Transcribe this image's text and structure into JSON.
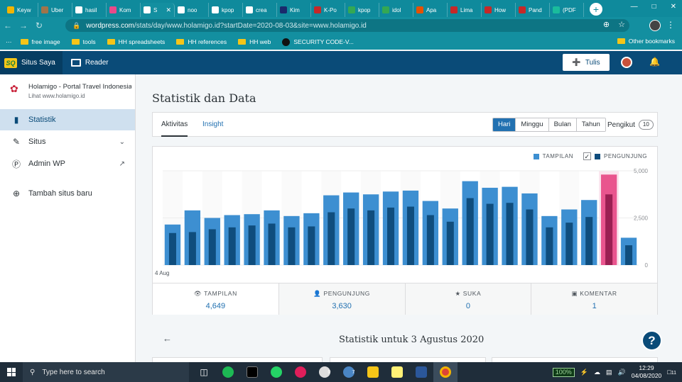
{
  "browser": {
    "tabs": [
      {
        "label": "Keyw",
        "color": "#f4b400"
      },
      {
        "label": "Uber",
        "color": "#a0744a"
      },
      {
        "label": "hasil",
        "color": "#ffffff"
      },
      {
        "label": "Kom",
        "color": "#e84a8a"
      },
      {
        "label": "S",
        "color": "#ffffff",
        "active": true
      },
      {
        "label": "noo",
        "color": "#ffffff"
      },
      {
        "label": "kpop",
        "color": "#ffffff"
      },
      {
        "label": "crea",
        "color": "#ffffff"
      },
      {
        "label": "Kim",
        "color": "#1a2a6c"
      },
      {
        "label": "K-Po",
        "color": "#c62828"
      },
      {
        "label": "kpop",
        "color": "#34a853"
      },
      {
        "label": "idol",
        "color": "#34a853"
      },
      {
        "label": "Apa",
        "color": "#e65100"
      },
      {
        "label": "Lima",
        "color": "#c62828"
      },
      {
        "label": "How",
        "color": "#c62828"
      },
      {
        "label": "Pand",
        "color": "#c62828"
      },
      {
        "label": "(PDF",
        "color": "#1abc9c"
      }
    ],
    "url_host": "wordpress.com",
    "url_rest": "/stats/day/www.holamigo.id?startDate=2020-08-03&site=www.holamigo.id",
    "bookmarks": [
      "free image",
      "tools",
      "HH spreadsheets",
      "HH references",
      "HH web",
      "SECURITY CODE-V..."
    ],
    "other_bookmarks": "Other bookmarks"
  },
  "masterbar": {
    "my_sites": "Situs Saya",
    "reader": "Reader",
    "write": "Tulis"
  },
  "sidebar": {
    "site_name": "Holamigo - Portal Travel Indonesia",
    "site_url": "Lihat www.holamigo.id",
    "items": [
      {
        "label": "Statistik",
        "icon": "bar-chart-icon"
      },
      {
        "label": "Situs",
        "icon": "pencil-icon"
      },
      {
        "label": "Admin WP",
        "icon": "wordpress-icon"
      },
      {
        "label": "Tambah situs baru",
        "icon": "plus-circle-icon"
      }
    ]
  },
  "main": {
    "title": "Statistik dan Data",
    "tabs": [
      "Aktivitas",
      "Insight"
    ],
    "periods": [
      "Hari",
      "Minggu",
      "Bulan",
      "Tahun"
    ],
    "active_period": "Hari",
    "followers_label": "Pengikut",
    "followers_count": "10",
    "subtitle": "Statistik untuk 3 Agustus 2020"
  },
  "chart_data": {
    "type": "bar",
    "legend": [
      "TAMPILAN",
      "PENGUNJUNG"
    ],
    "x_first_label": "4 Aug",
    "y_ticks": [
      "5,000",
      "2,500",
      "0"
    ],
    "ylim": [
      0,
      5000
    ],
    "colors": {
      "views": "#3d8fd1",
      "visitors": "#0f4d7d",
      "views_selected": "#e9558e",
      "visitors_selected": "#9a1f52",
      "highlight": "#fbe4ee"
    },
    "selected_index": 22,
    "series": [
      {
        "name": "TAMPILAN",
        "values": [
          2150,
          2900,
          2500,
          2650,
          2700,
          2900,
          2600,
          2750,
          3700,
          3850,
          3750,
          3900,
          3950,
          3400,
          3000,
          4450,
          4100,
          4150,
          3800,
          2600,
          2950,
          3450,
          4800,
          1450
        ]
      },
      {
        "name": "PENGUNJUNG",
        "values": [
          1700,
          1750,
          1900,
          2000,
          2100,
          2200,
          2000,
          2050,
          2800,
          3000,
          2900,
          3050,
          3100,
          2650,
          2300,
          3550,
          3250,
          3300,
          2950,
          2000,
          2250,
          2550,
          3750,
          1050
        ]
      }
    ]
  },
  "summary": [
    {
      "label": "TAMPILAN",
      "value": "4,649",
      "icon": "eye-icon"
    },
    {
      "label": "PENGUNJUNG",
      "value": "3,630",
      "icon": "person-icon"
    },
    {
      "label": "SUKA",
      "value": "0",
      "icon": "star-icon"
    },
    {
      "label": "KOMENTAR",
      "value": "1",
      "icon": "comment-icon"
    }
  ],
  "taskbar": {
    "search_placeholder": "Type here to search",
    "battery": "100%",
    "time": "12:29",
    "date": "04/08/2020",
    "notif_count": "11",
    "badge_a": "0",
    "badge_b": "7"
  }
}
